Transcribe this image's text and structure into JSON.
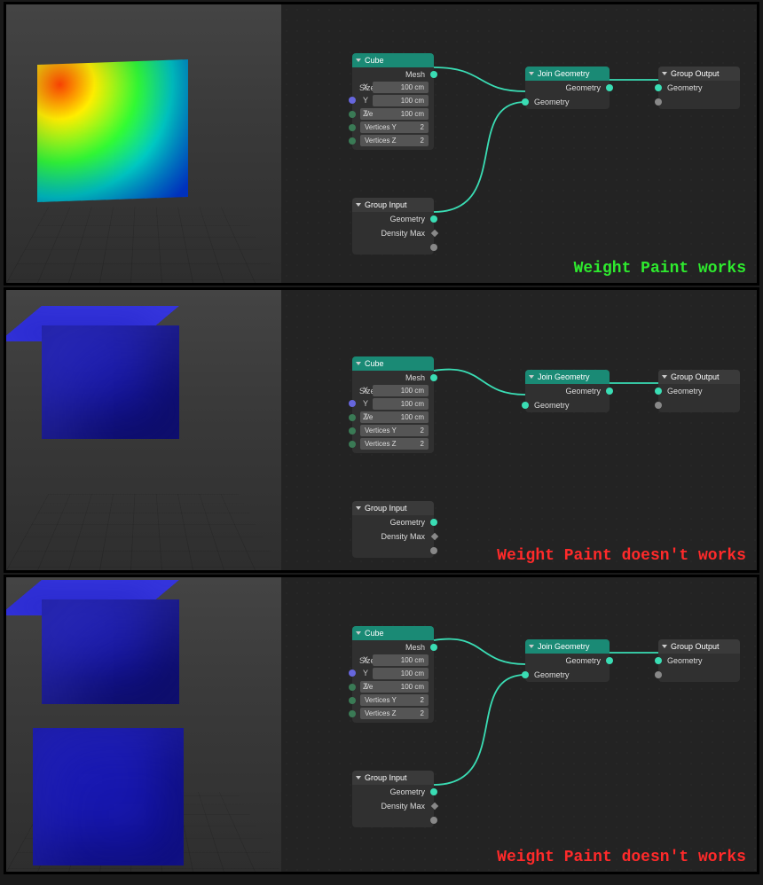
{
  "captions": {
    "works": "Weight Paint works",
    "no1": "Weight Paint doesn't works",
    "no2": "Weight Paint doesn't works"
  },
  "nodes": {
    "cube": {
      "title": "Cube",
      "mesh": "Mesh",
      "size_label": "Size:",
      "x": "X",
      "y": "Y",
      "z": "Z",
      "dim": "100 cm",
      "vx": "Vertices X",
      "vy": "Vertices Y",
      "vz": "Vertices Z",
      "vcount": "2"
    },
    "group_input": {
      "title": "Group Input",
      "geometry": "Geometry",
      "density": "Density Max"
    },
    "join": {
      "title": "Join Geometry",
      "geometry": "Geometry"
    },
    "group_output": {
      "title": "Group Output",
      "geometry": "Geometry"
    }
  }
}
